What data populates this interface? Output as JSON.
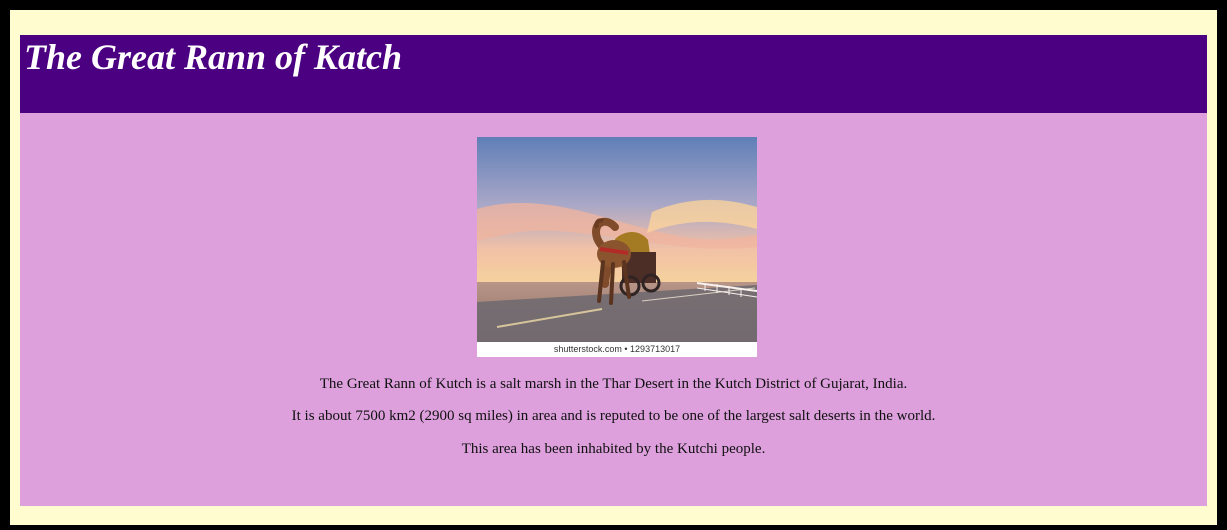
{
  "page": {
    "title": "The Great Rann of Katch"
  },
  "image": {
    "watermark": "shutterstock.com • 1293713017"
  },
  "paragraphs": [
    "The Great Rann of Kutch is a salt marsh in the Thar Desert in the Kutch District of Gujarat, India.",
    "It is about 7500 km2 (2900 sq miles) in area and is reputed to be one of the largest salt deserts in the world.",
    "This area has been inhabited by the Kutchi people."
  ],
  "colors": {
    "outer_border": "#000000",
    "page_background": "#fffdd0",
    "header_background": "#4b0082",
    "content_background": "#dda0dd",
    "title_text": "#ffffff"
  }
}
